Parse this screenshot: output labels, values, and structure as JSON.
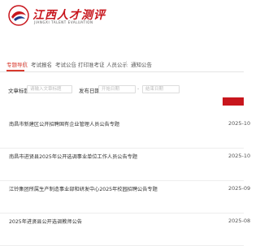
{
  "brand": {
    "name": "江西人才测评",
    "subtitle": "JIANGXI TALENT EVALUATION",
    "logo_icon": "eagle-emblem-icon",
    "accent_color": "#c8161d"
  },
  "tabs": [
    {
      "label": "专题导航"
    },
    {
      "label": "考试报名"
    },
    {
      "label": "考试公告"
    },
    {
      "label": "打印准考证"
    },
    {
      "label": "人员公示"
    },
    {
      "label": "通知公告"
    }
  ],
  "search": {
    "name_label": "文章标题",
    "name_placeholder": "请输入文章标题",
    "date_label": "发布日期",
    "start_placeholder": "开始日期",
    "end_placeholder": "结束日期",
    "range_sep": "-"
  },
  "articles": [
    {
      "title": "南昌市新建区公开招聘国有企业管理人员公告专题",
      "date": "2025-10"
    },
    {
      "title": "南昌市进贤县2025年公开选调事业单位工作人员公告专题",
      "date": "2025-10"
    },
    {
      "title": "江铃集团所属生产制造事业部和研发中心2025年校园招聘公告专题",
      "date": "2025-09"
    },
    {
      "title": "2025年进贤县公开选调教师公告",
      "date": "2025-08"
    }
  ]
}
